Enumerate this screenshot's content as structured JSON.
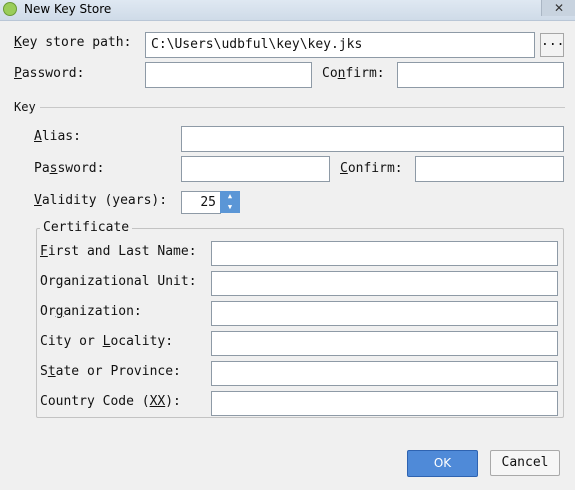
{
  "window": {
    "title": "New Key Store",
    "icon": "android-icon",
    "close_glyph": "✕"
  },
  "keystore": {
    "path_label_underline": "K",
    "path_label_rest": "ey store path:",
    "path_value": "C:\\Users\\udbful\\key\\key.jks",
    "browse_label": "...",
    "password_label_underline": "P",
    "password_label_rest": "assword:",
    "password_value": "",
    "confirm_label_pre": "Co",
    "confirm_label_underline": "n",
    "confirm_label_rest": "firm:",
    "confirm_value": ""
  },
  "key": {
    "section_title": "Key",
    "alias_label_underline": "A",
    "alias_label_rest": "lias:",
    "alias_value": "",
    "password_label_pre": "Pa",
    "password_label_underline": "s",
    "password_label_rest": "sword:",
    "password_value": "",
    "confirm_label_underline": "C",
    "confirm_label_rest": "onfirm:",
    "confirm_value": "",
    "validity_label_underline": "V",
    "validity_label_rest": "alidity (years):",
    "validity_value": "25"
  },
  "certificate": {
    "legend": "Certificate",
    "first_last_label_underline": "F",
    "first_last_label_rest": "irst and Last Name:",
    "first_last_value": "",
    "org_unit_label": "Organizational Unit:",
    "org_unit_value": "",
    "org_label_pre": "Or",
    "org_label_underline": "g",
    "org_label_rest": "anization:",
    "org_value": "",
    "city_label_pre": "City or ",
    "city_label_underline": "L",
    "city_label_rest": "ocality:",
    "city_value": "",
    "state_label_pre": "S",
    "state_label_underline": "t",
    "state_label_rest": "ate or Province:",
    "state_value": "",
    "country_label_pre": "Country Code (",
    "country_label_underline": "XX",
    "country_label_rest": "):",
    "country_value": ""
  },
  "buttons": {
    "ok": "OK",
    "cancel": "Cancel"
  },
  "colors": {
    "ok_bg": "#4f8ad8",
    "spinner_bg": "#5b96d6",
    "window_bg": "#f0f0f0"
  }
}
